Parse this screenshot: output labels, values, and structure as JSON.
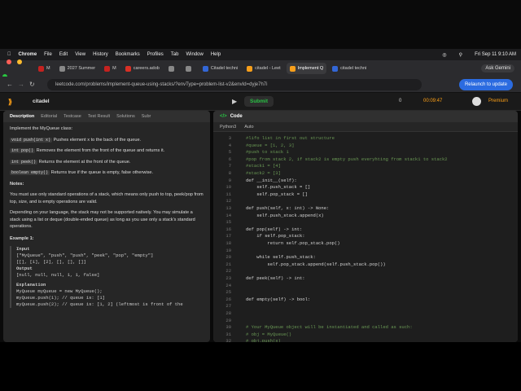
{
  "menubar": {
    "app": "Chrome",
    "items": [
      "File",
      "Edit",
      "View",
      "History",
      "Bookmarks",
      "Profiles",
      "Tab",
      "Window",
      "Help"
    ],
    "clock": "Fri Sep 11  9:10 AM"
  },
  "tabs": [
    {
      "label": "M",
      "color": "#c5221f"
    },
    {
      "label": "2027 Summer",
      "color": "#888"
    },
    {
      "label": "M",
      "color": "#c5221f"
    },
    {
      "label": "careers.adob",
      "color": "#d93025"
    },
    {
      "label": "",
      "color": "#888"
    },
    {
      "label": "",
      "color": "#888"
    },
    {
      "label": "Citadel techni",
      "color": "#3367d6"
    },
    {
      "label": "citadel - Leet",
      "color": "#f89f1b"
    },
    {
      "label": "Implement Q",
      "color": "#f89f1b",
      "active": true
    },
    {
      "label": "citadel techni",
      "color": "#3367d6"
    }
  ],
  "ask_gemini": "Ask Gemini",
  "url": "leetcode.com/problems/implement-queue-using-stacks/?envType=problem-list-v2&envId=dyje7h7i",
  "relaunch": "Relaunch to update",
  "header": {
    "list": "citadel",
    "submit": "Submit",
    "timer": "00:09:47",
    "streak": "0",
    "premium": "Premium"
  },
  "left_tabs": [
    "Description",
    "Editorial",
    "Testcase",
    "Test Result",
    "Solutions",
    "Subr"
  ],
  "desc": {
    "intro": "Implement the MyQueue class:",
    "bullets": [
      {
        "code": "void push(int x)",
        "text": " Pushes element x to the back of the queue."
      },
      {
        "code": "int pop()",
        "text": " Removes the element from the front of the queue and returns it."
      },
      {
        "code": "int peek()",
        "text": " Returns the element at the front of the queue."
      },
      {
        "code": "boolean empty()",
        "text": " Returns true if the queue is empty, false otherwise."
      }
    ],
    "notes_title": "Notes:",
    "note1": "You must use only standard operations of a stack, which means only push to top, peek/pop from top, size, and is empty operations are valid.",
    "note2": "Depending on your language, the stack may not be supported natively. You may simulate a stack using a list or deque (double-ended queue) as long as you use only a stack's standard operations.",
    "example_title": "Example 1:",
    "input_label": "Input",
    "input1": "[\"MyQueue\", \"push\", \"push\", \"peek\", \"pop\", \"empty\"]",
    "input2": "[[], [1], [2], [], [], []]",
    "output_label": "Output",
    "output": "[null, null, null, 1, 1, false]",
    "explanation_label": "Explanation",
    "exp1": "MyQueue myQueue = new MyQueue();",
    "exp2": "myQueue.push(1); // queue is: [1]",
    "exp3": "myQueue.push(2); // queue is: [1, 2] (leftmost is front of the"
  },
  "code_title": "Code",
  "lang": "Python3",
  "auto": "Auto",
  "code_lines": [
    {
      "n": "3",
      "t": "#lifo list in first out structure",
      "c": "cm"
    },
    {
      "n": "4",
      "t": "#queue = [1, 2, 3]",
      "c": "cm"
    },
    {
      "n": "5",
      "t": "#push to stack 1",
      "c": "cm"
    },
    {
      "n": "6",
      "t": "#pop from stack 2, if stack2 is empty push everyhting from stack1 to stack2",
      "c": "cm"
    },
    {
      "n": "7",
      "t": "#stack1 = [4]",
      "c": "cm"
    },
    {
      "n": "8",
      "t": "#stack2 = [3]",
      "c": "cm"
    },
    {
      "n": "9",
      "t": "def __init__(self):",
      "c": ""
    },
    {
      "n": "10",
      "t": "    self.push_stack = []",
      "c": ""
    },
    {
      "n": "11",
      "t": "    self.pop_stack = []",
      "c": ""
    },
    {
      "n": "12",
      "t": "",
      "c": ""
    },
    {
      "n": "13",
      "t": "def push(self, x: int) -> None:",
      "c": ""
    },
    {
      "n": "14",
      "t": "    self.push_stack.append(x)",
      "c": ""
    },
    {
      "n": "15",
      "t": "",
      "c": ""
    },
    {
      "n": "16",
      "t": "def pop(self) -> int:",
      "c": ""
    },
    {
      "n": "17",
      "t": "    if self.pop_stack:",
      "c": ""
    },
    {
      "n": "18",
      "t": "        return self.pop_stack.pop()",
      "c": ""
    },
    {
      "n": "19",
      "t": "",
      "c": ""
    },
    {
      "n": "20",
      "t": "    while self.push_stack:",
      "c": ""
    },
    {
      "n": "21",
      "t": "        self.pop_stack.append(self.push_stack.pop())",
      "c": ""
    },
    {
      "n": "22",
      "t": "",
      "c": ""
    },
    {
      "n": "23",
      "t": "def peek(self) -> int:",
      "c": ""
    },
    {
      "n": "24",
      "t": "",
      "c": ""
    },
    {
      "n": "25",
      "t": "",
      "c": ""
    },
    {
      "n": "26",
      "t": "def empty(self) -> bool:",
      "c": ""
    },
    {
      "n": "27",
      "t": "",
      "c": ""
    },
    {
      "n": "28",
      "t": "",
      "c": ""
    },
    {
      "n": "29",
      "t": "",
      "c": ""
    },
    {
      "n": "30",
      "t": "# Your MyQueue object will be instantiated and called as such:",
      "c": "cm"
    },
    {
      "n": "31",
      "t": "# obj = MyQueue()",
      "c": "cm"
    },
    {
      "n": "32",
      "t": "# obj.push(x)",
      "c": "cm"
    }
  ]
}
